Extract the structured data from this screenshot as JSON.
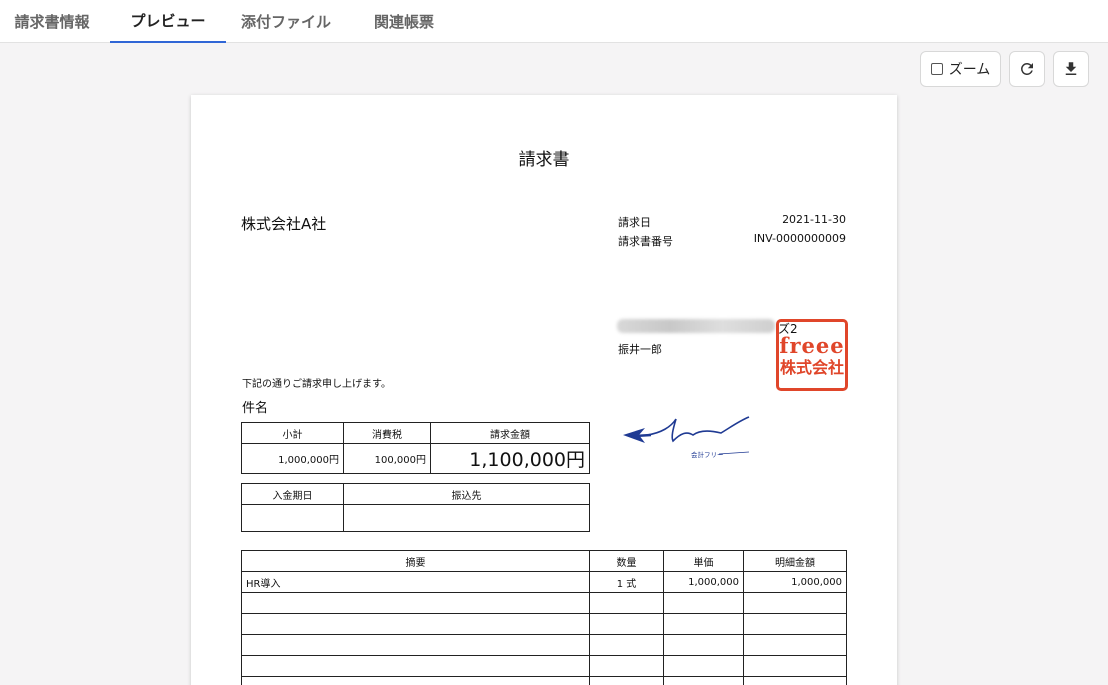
{
  "tabs": [
    {
      "label": "請求書情報",
      "active": false
    },
    {
      "label": "プレビュー",
      "active": true
    },
    {
      "label": "添付ファイル",
      "active": false
    },
    {
      "label": "関連帳票",
      "active": false
    }
  ],
  "toolbar": {
    "zoom_label": "ズーム",
    "zoom_checked": false,
    "reload_icon": "reload-icon",
    "download_icon": "download-icon"
  },
  "invoice": {
    "title": "請求書",
    "client": "株式会社A社",
    "meta": [
      {
        "label": "請求日",
        "value": "2021-11-30"
      },
      {
        "label": "請求書番号",
        "value": "INV-0000000009"
      }
    ],
    "issuer_partial": "ズ2",
    "issuer_person": "振井一郎",
    "stamp": {
      "line1": "freee",
      "line2": "株式会社"
    },
    "logo": {
      "text": "会計フリー"
    },
    "greeting": "下記の通りご請求申し上げます。",
    "subject_label": "件名",
    "summary": {
      "headers": [
        "小計",
        "消費税",
        "請求金額"
      ],
      "values": [
        "1,000,000円",
        "100,000円",
        "1,100,000円"
      ]
    },
    "payment": {
      "headers": [
        "入金期日",
        "振込先"
      ],
      "values": [
        "",
        ""
      ]
    },
    "items": {
      "headers": [
        "摘要",
        "数量",
        "単価",
        "明細金額"
      ],
      "rows": [
        [
          "HR導入",
          "1 式",
          "1,000,000",
          "1,000,000"
        ],
        [
          "",
          "",
          "",
          ""
        ],
        [
          "",
          "",
          "",
          ""
        ],
        [
          "",
          "",
          "",
          ""
        ],
        [
          "",
          "",
          "",
          ""
        ],
        [
          "",
          "",
          "",
          ""
        ]
      ]
    }
  },
  "colors": {
    "accent": "#3066d6",
    "stamp": "#e0462a",
    "logo": "#1f3a93"
  }
}
